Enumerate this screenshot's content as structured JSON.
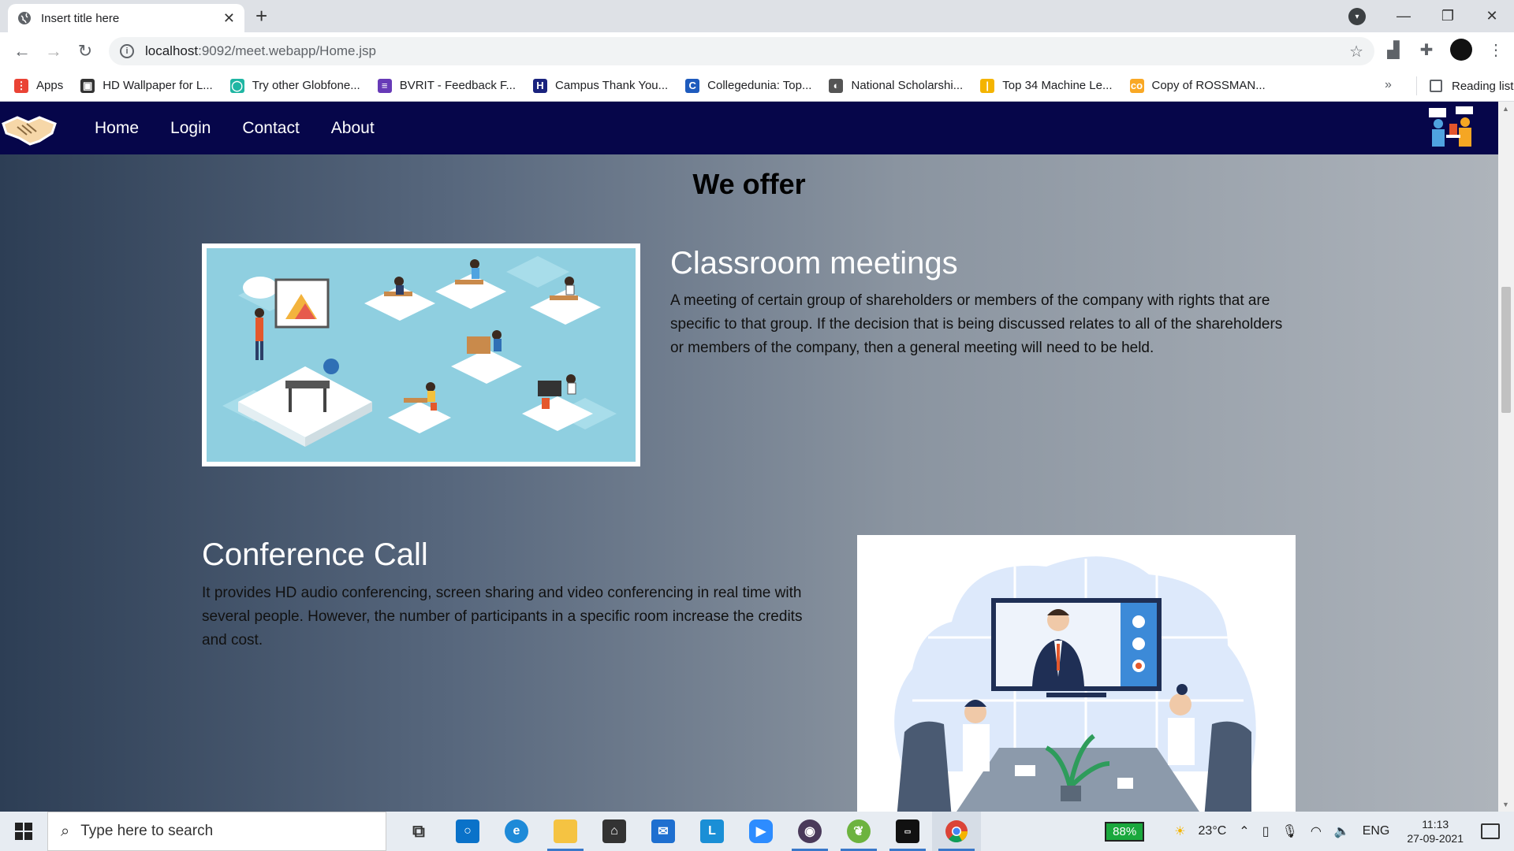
{
  "browser": {
    "tab_title": "Insert title here",
    "url_host": "localhost",
    "url_rest": ":9092/meet.webapp/Home.jsp",
    "bookmarks": [
      {
        "label": "Apps",
        "color": "#ea4335",
        "glyph": "⋮"
      },
      {
        "label": "HD Wallpaper for L...",
        "color": "#333333",
        "glyph": "▣"
      },
      {
        "label": "Try other Globfone...",
        "color": "#1fb6a3",
        "glyph": "◯"
      },
      {
        "label": "BVRIT - Feedback F...",
        "color": "#673ab7",
        "glyph": "≡"
      },
      {
        "label": "Campus Thank You...",
        "color": "#1a237e",
        "glyph": "H"
      },
      {
        "label": "Collegedunia: Top...",
        "color": "#1e5bbd",
        "glyph": "C"
      },
      {
        "label": "National Scholarshi...",
        "color": "#555555",
        "glyph": "◐"
      },
      {
        "label": "Top 34 Machine Le...",
        "color": "#f4b400",
        "glyph": "|"
      },
      {
        "label": "Copy of ROSSMAN...",
        "color": "#f9a825",
        "glyph": "co"
      }
    ],
    "more": "»",
    "reading_list": "Reading list"
  },
  "site": {
    "nav": [
      "Home",
      "Login",
      "Contact",
      "About"
    ],
    "heading": "We offer",
    "sections": [
      {
        "title": "Classroom meetings",
        "text": "A meeting of certain group of shareholders or members of the company with rights that are specific to that group. If the decision that is being discussed relates to all of the shareholders or members of the company, then a general meeting will need to be held."
      },
      {
        "title": "Conference Call",
        "text": "It provides HD audio conferencing, screen sharing and video conferencing in real time with several people. However, the number of participants in a specific room increase the credits and cost."
      }
    ]
  },
  "taskbar": {
    "search_placeholder": "Type here to search",
    "battery": "88%",
    "weather": "23°C",
    "lang": "ENG",
    "time": "11:13",
    "date": "27-09-2021"
  }
}
